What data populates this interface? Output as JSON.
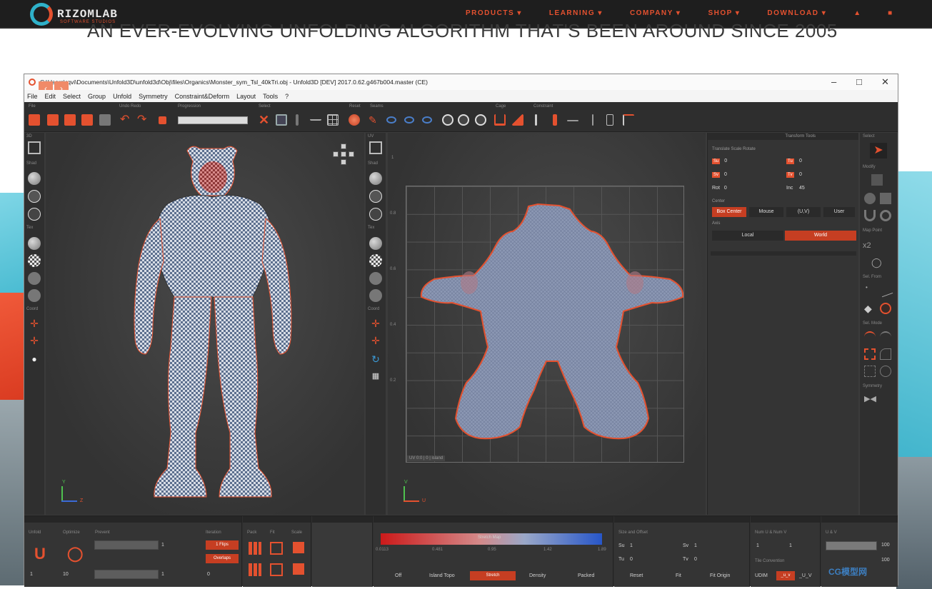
{
  "site": {
    "logo_text": "RIZOMLAB",
    "logo_sub": "SOFTWARE STUDIOS",
    "menu": [
      "PRODUCTS ▾",
      "LEARNING ▾",
      "COMPANY ▾",
      "SHOP ▾",
      "DOWNLOAD ▾"
    ],
    "user_icon": "user-icon",
    "cart_icon": "cart-icon",
    "headline": "AN EVER-EVOLVING UNFOLDING ALGORITHM THAT'S BEEN AROUND SINCE 2005",
    "accent": "#e4512f"
  },
  "app": {
    "title": "C:\\Users\\rqvi\\Documents\\Unfold3D\\unfold3d\\Obj\\files\\Organics\\Monster_sym_Tsl_40kTri.obj - Unfold3D [DEV] 2017.0.62.g467b004.master (CE)",
    "window_controls": [
      "–",
      "□",
      "✕"
    ],
    "menu": [
      "File",
      "Edit",
      "Select",
      "Group",
      "Unfold",
      "Symmetry",
      "Constraint&Deform",
      "Layout",
      "Tools",
      "?"
    ],
    "toolbar_groups": [
      "File",
      "Undo Redo",
      "Progression",
      "Select",
      "Reset",
      "Seams",
      "Cage",
      "Constraint"
    ],
    "left_strip_labels": [
      "3D",
      "Shad",
      "Tex",
      "Coord"
    ],
    "uv_strip_labels": [
      "UV",
      "Shad",
      "Tex",
      "Coord"
    ],
    "uv_info": "UV 0:0 | 0 | island",
    "uv_ticks": [
      "1",
      "0.8",
      "0.6",
      "0.4",
      "0.2"
    ],
    "gizmo_3d": {
      "y": "Y",
      "z": "Z"
    },
    "gizmo_uv": {
      "v": "V",
      "u": "U"
    }
  },
  "right_panel": {
    "header": "Transform Tools",
    "title": "Translate Scale Rotate",
    "rows": [
      {
        "label": "Su",
        "value": "0",
        "label2": "Tu",
        "value2": "0"
      },
      {
        "label": "Sv",
        "value": "0",
        "label2": "Tv",
        "value2": "0"
      },
      {
        "label": "Rot",
        "value": "0",
        "label2": "Inc",
        "value2": "45"
      }
    ],
    "center_label": "Center",
    "center_options": [
      "Box Center",
      "Mouse",
      "(U,V)",
      "User"
    ],
    "axis_label": "Axis",
    "axis_options": [
      "Local",
      "World"
    ]
  },
  "select_strip": {
    "labels": [
      "Select",
      "Modify",
      "Map Point",
      "Sel. From",
      "Sel. Mode",
      "Symmetry"
    ],
    "x2_label": "x2"
  },
  "bottom": {
    "unfold": {
      "header": "Unfold",
      "labels": [
        "Unfold",
        "Optimize",
        "Prevent",
        "Iteration"
      ],
      "fields": [
        "1",
        "1",
        "1",
        "10",
        "0"
      ],
      "buttons": [
        "1 Flips",
        "Overlaps"
      ]
    },
    "pack": {
      "header": "Pack/Fit",
      "labels": [
        "Pack",
        "Fit",
        "Scale"
      ]
    },
    "distortion": {
      "header": "Distortion",
      "bar_label": "Stretch Map",
      "ticks": [
        "0.0113",
        "0.481",
        "0.95",
        "1.42",
        "1.89"
      ],
      "modes": [
        "Off",
        "Island Topo",
        "Stretch",
        "Density",
        "Packed"
      ]
    },
    "tile": {
      "header": "Tile",
      "title": "Size and Offset",
      "rows": [
        {
          "label": "Su",
          "value": "1",
          "label2": "Sv",
          "value2": "1"
        },
        {
          "label": "Tu",
          "value": "0",
          "label2": "Tv",
          "value2": "0"
        }
      ],
      "buttons": [
        "Reset",
        "Fit",
        "Fit Origin"
      ]
    },
    "multi_tile": {
      "header": "Multi Tile",
      "title": "Num U & Num V",
      "values": [
        "1",
        "1"
      ],
      "convention_label": "Tile Convention",
      "conventions": [
        "UDIM",
        "_u_v",
        "_U_V"
      ]
    },
    "uv_panel": {
      "header": "U & V",
      "values": [
        "100",
        "100"
      ]
    }
  },
  "watermark": "CG模型网"
}
